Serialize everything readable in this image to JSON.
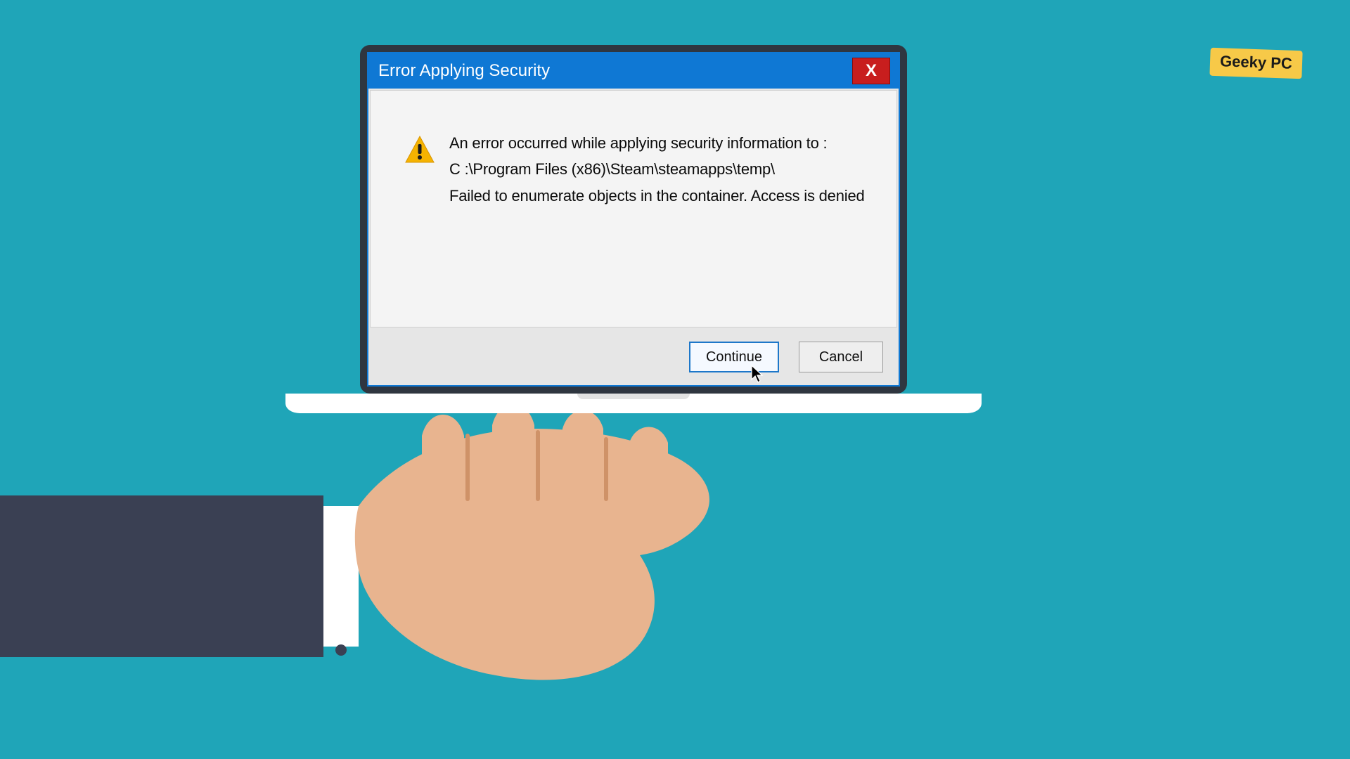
{
  "brand": {
    "label": "Geeky PC"
  },
  "dialog": {
    "title": "Error Applying Security",
    "close_glyph": "X",
    "message": {
      "line1": "An error occurred while applying security information to :",
      "line2": "C :\\Program Files (x86)\\Steam\\steamapps\\temp\\",
      "line3": "Failed to enumerate objects in the container. Access is denied"
    },
    "buttons": {
      "continue": "Continue",
      "cancel": "Cancel"
    }
  },
  "colors": {
    "background": "#1fa5b8",
    "titlebar": "#0f78d4",
    "close": "#c81e1e",
    "warning": "#f5b301"
  }
}
